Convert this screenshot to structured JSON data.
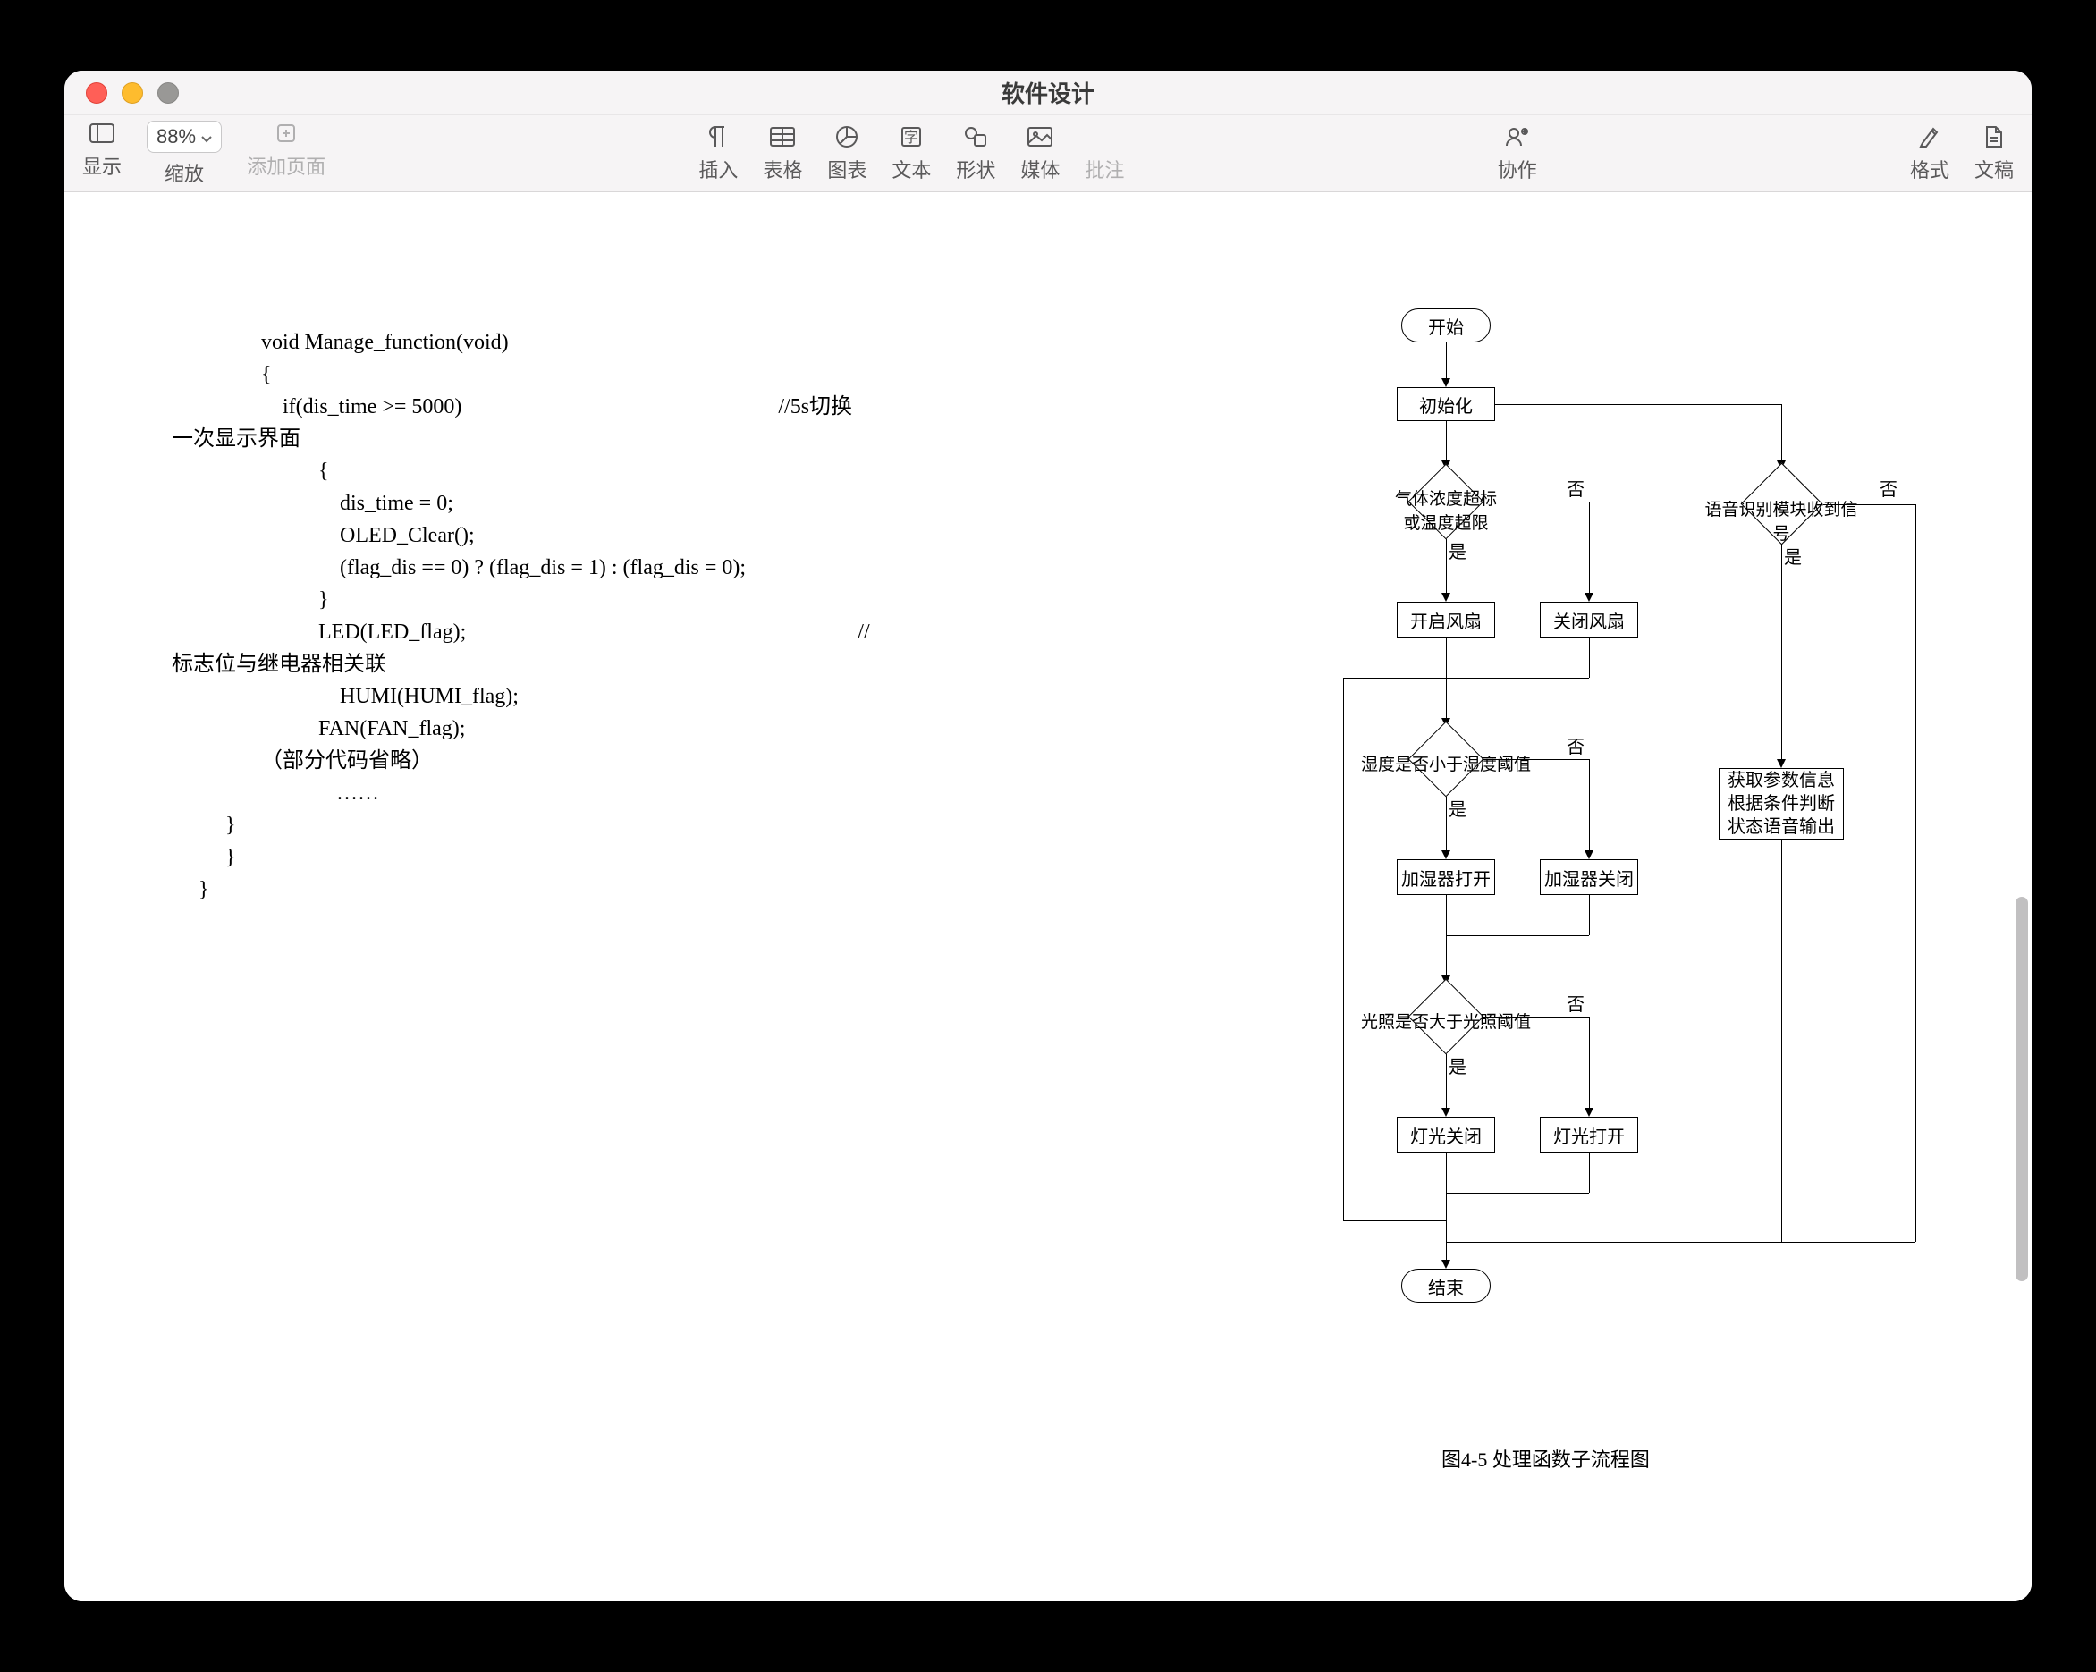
{
  "window": {
    "title": "软件设计"
  },
  "toolbar": {
    "show": "显示",
    "zoom": "缩放",
    "zoom_value": "88%",
    "add_page": "添加页面",
    "insert": "插入",
    "table": "表格",
    "chart": "图表",
    "text": "文本",
    "shape": "形状",
    "media": "媒体",
    "comment": "批注",
    "collaborate": "协作",
    "format": "格式",
    "document": "文稿"
  },
  "code": {
    "l1": "void Manage_function(void)",
    "l2": "{",
    "l3": "    if(dis_time >= 5000)                                                           //5s切换",
    "l3b": "一次显示界面",
    "l4": "    {",
    "l5": "        dis_time = 0;",
    "l6": "        OLED_Clear();",
    "l7": "        (flag_dis == 0) ? (flag_dis = 1) : (flag_dis = 0);",
    "l8": "    }",
    "l9": "",
    "l10": "    LED(LED_flag);                                                                         //",
    "l10b": "标志位与继电器相关联",
    "l11": "        HUMI(HUMI_flag);",
    "l12": "    FAN(FAN_flag);",
    "l13": "（部分代码省略）",
    "l14": "    ……",
    "l15": "}",
    "l16": "}",
    "l17": "",
    "l18": "}"
  },
  "flow": {
    "start": "开始",
    "init": "初始化",
    "d1": "气体浓度超标\n或温度超限",
    "fan_on": "开启风扇",
    "fan_off": "关闭风扇",
    "d2": "湿度是否小于湿度阈值",
    "humid_on": "加湿器打开",
    "humid_off": "加湿器关闭",
    "d3": "光照是否大于光照阈值",
    "light_off": "灯光关闭",
    "light_on": "灯光打开",
    "voice_check": "语音识别模块收到信号",
    "voice_out": "获取参数信息\n根据条件判断\n状态语音输出",
    "end": "结束",
    "yes": "是",
    "no": "否"
  },
  "caption": "图4-5      处理函数子流程图",
  "chart_data": {
    "type": "flowchart",
    "title": "处理函数子流程图 (Handler function sub-flowchart)",
    "nodes": [
      {
        "id": "start",
        "type": "terminal",
        "label": "开始"
      },
      {
        "id": "init",
        "type": "process",
        "label": "初始化"
      },
      {
        "id": "d1",
        "type": "decision",
        "label": "气体浓度超标或温度超限"
      },
      {
        "id": "fan_on",
        "type": "process",
        "label": "开启风扇"
      },
      {
        "id": "fan_off",
        "type": "process",
        "label": "关闭风扇"
      },
      {
        "id": "d2",
        "type": "decision",
        "label": "湿度是否小于湿度阈值"
      },
      {
        "id": "humid_on",
        "type": "process",
        "label": "加湿器打开"
      },
      {
        "id": "humid_off",
        "type": "process",
        "label": "加湿器关闭"
      },
      {
        "id": "d3",
        "type": "decision",
        "label": "光照是否大于光照阈值"
      },
      {
        "id": "light_off",
        "type": "process",
        "label": "灯光关闭"
      },
      {
        "id": "light_on",
        "type": "process",
        "label": "灯光打开"
      },
      {
        "id": "voice_check",
        "type": "decision",
        "label": "语音识别模块收到信号"
      },
      {
        "id": "voice_out",
        "type": "process",
        "label": "获取参数信息根据条件判断状态语音输出"
      },
      {
        "id": "end",
        "type": "terminal",
        "label": "结束"
      }
    ],
    "edges": [
      {
        "from": "start",
        "to": "init"
      },
      {
        "from": "init",
        "to": "d1"
      },
      {
        "from": "init",
        "to": "voice_check"
      },
      {
        "from": "d1",
        "to": "fan_on",
        "label": "是"
      },
      {
        "from": "d1",
        "to": "fan_off",
        "label": "否"
      },
      {
        "from": "fan_on",
        "to": "d2"
      },
      {
        "from": "fan_off",
        "to": "d2"
      },
      {
        "from": "d2",
        "to": "humid_on",
        "label": "是"
      },
      {
        "from": "d2",
        "to": "humid_off",
        "label": "否"
      },
      {
        "from": "humid_on",
        "to": "d3"
      },
      {
        "from": "humid_off",
        "to": "d3"
      },
      {
        "from": "d3",
        "to": "light_off",
        "label": "是"
      },
      {
        "from": "d3",
        "to": "light_on",
        "label": "否"
      },
      {
        "from": "light_off",
        "to": "end"
      },
      {
        "from": "light_on",
        "to": "end"
      },
      {
        "from": "voice_check",
        "to": "voice_out",
        "label": "是"
      },
      {
        "from": "voice_check",
        "to": "end",
        "label": "否"
      },
      {
        "from": "voice_out",
        "to": "end"
      }
    ]
  }
}
